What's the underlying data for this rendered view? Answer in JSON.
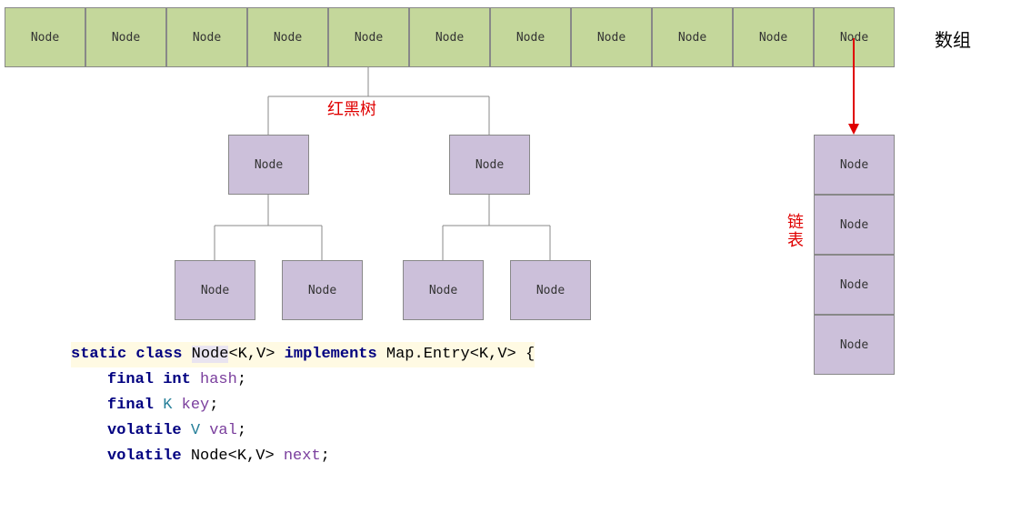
{
  "labels": {
    "array": "数组",
    "redblack_tree": "红黑树",
    "linked_list": "链表"
  },
  "array_cells": [
    "Node",
    "Node",
    "Node",
    "Node",
    "Node",
    "Node",
    "Node",
    "Node",
    "Node",
    "Node",
    "Node"
  ],
  "tree_nodes": {
    "level1_left": "Node",
    "level1_right": "Node",
    "level2_1": "Node",
    "level2_2": "Node",
    "level2_3": "Node",
    "level2_4": "Node"
  },
  "linked_list_nodes": [
    "Node",
    "Node",
    "Node",
    "Node"
  ],
  "code": {
    "l1_static": "static",
    "l1_class": "class",
    "l1_Node": "Node",
    "l1_KV": "<K,V>",
    "l1_implements": "implements",
    "l1_MapEntry": "Map.Entry",
    "l1_KV2": "<K,V>",
    "l1_brace": " {",
    "l2_final": "final",
    "l2_int": "int",
    "l2_hash": "hash",
    "l3_final": "final",
    "l3_K": "K",
    "l3_key": "key",
    "l4_volatile": "volatile",
    "l4_V": "V",
    "l4_val": "val",
    "l5_volatile": "volatile",
    "l5_Node": "Node",
    "l5_KV": "<K,V>",
    "l5_next": "next",
    "semicolon": ";"
  }
}
